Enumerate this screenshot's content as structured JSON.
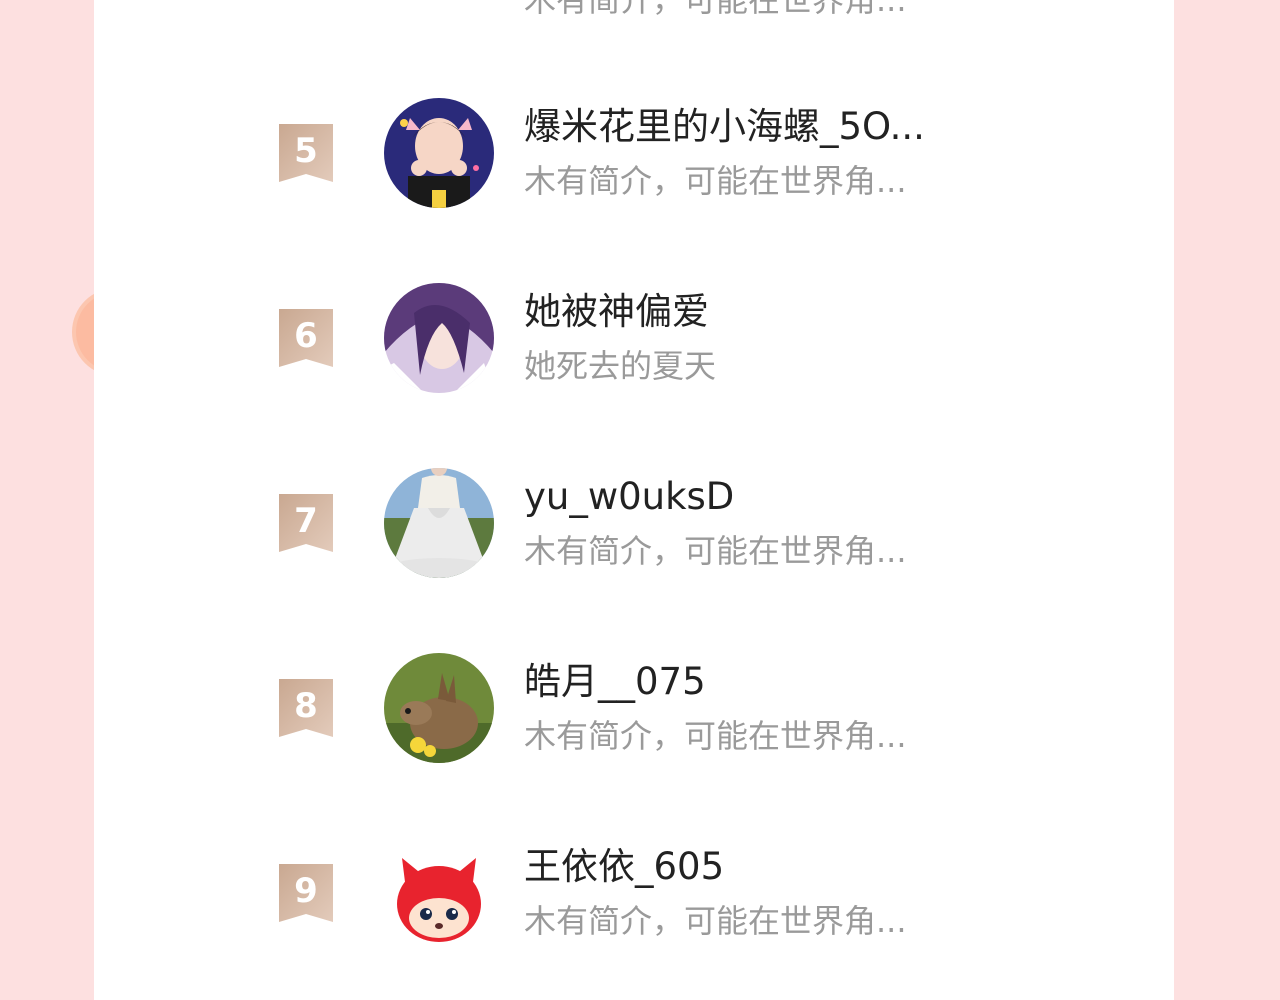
{
  "rows": [
    {
      "rank": "",
      "name": "",
      "desc": "木有简介，可能在世界角...",
      "avatar": "partial-avatar"
    },
    {
      "rank": "5",
      "name": "爆米花里的小海螺_5O...",
      "desc": "木有简介，可能在世界角...",
      "avatar": "boy-avatar"
    },
    {
      "rank": "6",
      "name": "她被神偏爱",
      "desc": "她死去的夏天",
      "avatar": "anime-avatar"
    },
    {
      "rank": "7",
      "name": "yu_w0uksD",
      "desc": "木有简介，可能在世界角...",
      "avatar": "dress-avatar"
    },
    {
      "rank": "8",
      "name": "皓月__075",
      "desc": "木有简介，可能在世界角...",
      "avatar": "deer-avatar"
    },
    {
      "rank": "9",
      "name": "王依依_605",
      "desc": "木有简介，可能在世界角...",
      "avatar": "fox-avatar"
    }
  ],
  "colors": {
    "page_bg": "#fde0e0",
    "card_bg": "#ffffff",
    "rank_badge": "#d2b39f",
    "name_text": "#222222",
    "desc_text": "#9a9a9a"
  }
}
